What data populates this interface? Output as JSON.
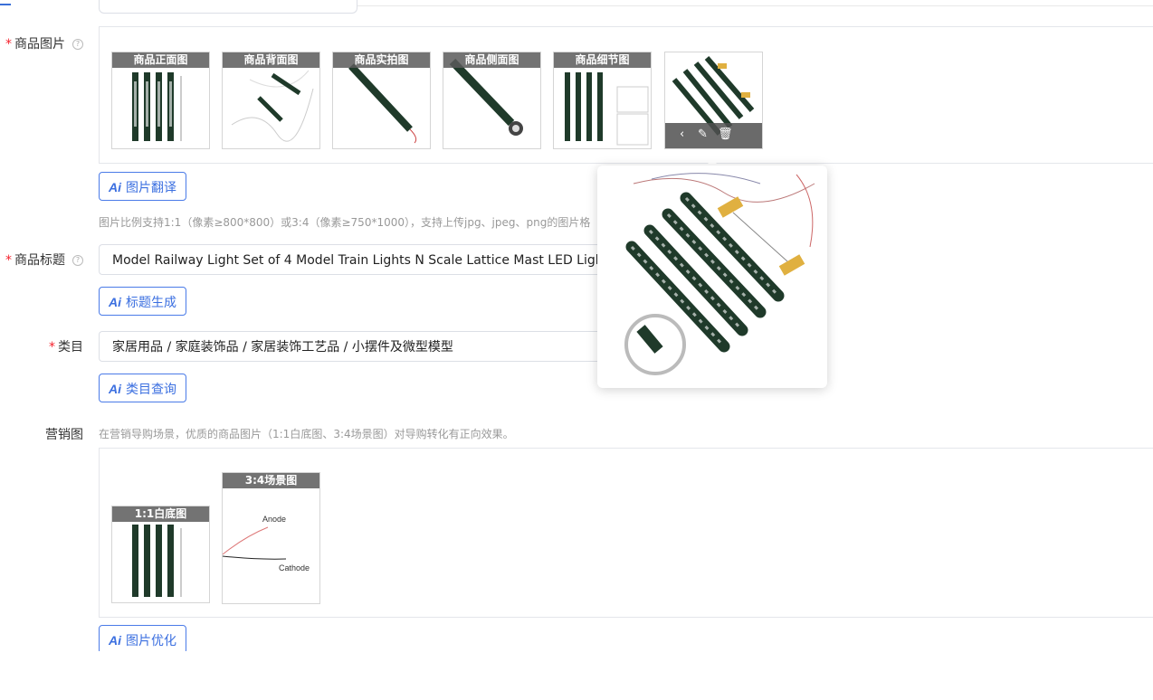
{
  "product_images": {
    "label": "商品图片",
    "help_icon": "question-circle-icon",
    "thumbnails": [
      {
        "caption": "商品正面图"
      },
      {
        "caption": "商品背面图"
      },
      {
        "caption": "商品实拍图"
      },
      {
        "caption": "商品侧面图"
      },
      {
        "caption": "商品细节图"
      },
      {
        "caption": ""
      }
    ],
    "overlay_icons": [
      "chevron-left-icon",
      "edit-icon",
      "delete-icon"
    ],
    "ai_button": {
      "ai": "Ai",
      "label": "图片翻译"
    },
    "hint": "图片比例支持1:1（像素≥800*800）或3:4（像素≥750*1000），支持上传jpg、jpeg、png的图片格"
  },
  "product_title": {
    "label": "商品标题",
    "value": "Model Railway Light Set of 4 Model Train Lights N Scale Lattice Mast LED Lights",
    "ai_button": {
      "ai": "Ai",
      "label": "标题生成"
    }
  },
  "category": {
    "label": "类目",
    "value": "家居用品 / 家庭装饰品 / 家居装饰工艺品 / 小摆件及微型模型",
    "ai_button": {
      "ai": "Ai",
      "label": "类目查询"
    }
  },
  "marketing": {
    "label": "营销图",
    "hint": "在营销导购场景，优质的商品图片（1:1白底图、3:4场景图）对导购转化有正向效果。",
    "thumbnails": [
      {
        "caption": "1:1白底图"
      },
      {
        "caption": "3:4场景图",
        "text_anode": "Anode",
        "text_cathode": "Cathode"
      }
    ],
    "ai_button": {
      "ai": "Ai",
      "label": "图片优化"
    }
  },
  "colors": {
    "accent": "#3b6fe0",
    "required": "#f5222d",
    "caption_bg": "#5a5a5a",
    "product_green": "#1f3a2a"
  }
}
